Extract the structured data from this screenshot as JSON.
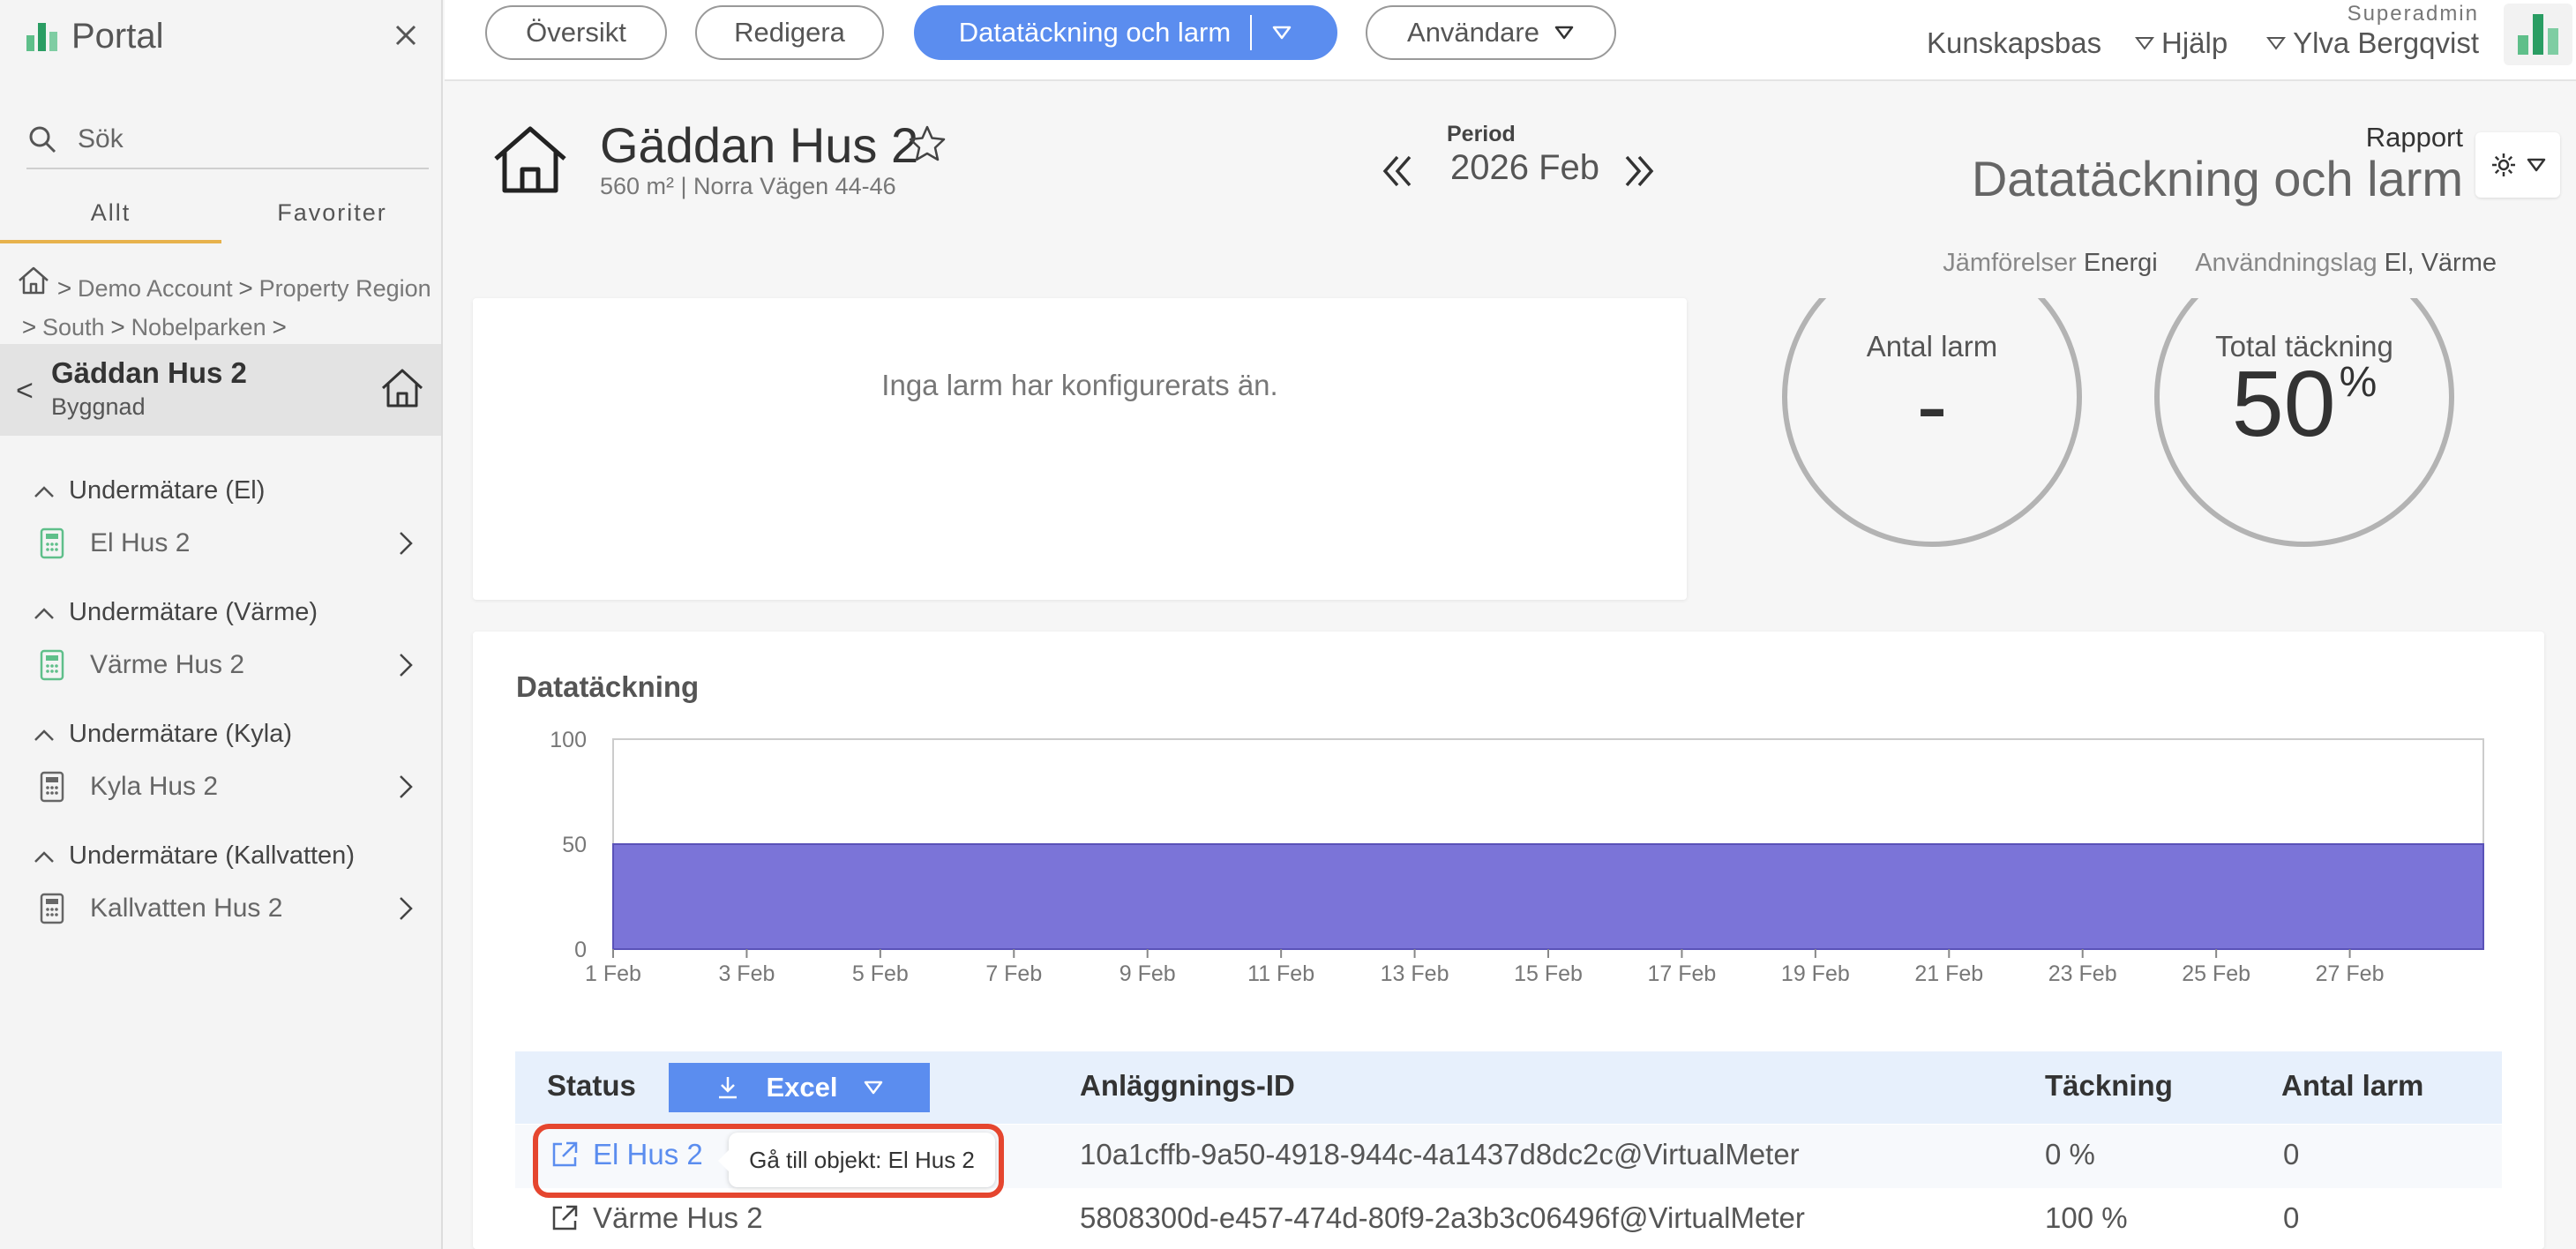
{
  "sidebar": {
    "title": "Portal",
    "search_placeholder": "Sök",
    "tabs": [
      {
        "label": "Allt"
      },
      {
        "label": "Favoriter"
      }
    ],
    "breadcrumb": [
      "Demo Account",
      "Property Region",
      "South",
      "Nobelparken"
    ],
    "current": {
      "name": "Gäddan Hus 2",
      "type": "Byggnad"
    },
    "groups": [
      {
        "title": "Undermätare (El)",
        "item": "El Hus 2",
        "icon_color": "#5fbf8a"
      },
      {
        "title": "Undermätare (Värme)",
        "item": "Värme Hus 2",
        "icon_color": "#5fbf8a"
      },
      {
        "title": "Undermätare (Kyla)",
        "item": "Kyla Hus 2",
        "icon_color": "#666666"
      },
      {
        "title": "Undermätare (Kallvatten)",
        "item": "Kallvatten Hus 2",
        "icon_color": "#666666"
      }
    ]
  },
  "topnav": {
    "tabs": [
      {
        "label": "Översikt"
      },
      {
        "label": "Redigera"
      },
      {
        "label": "Datatäckning och larm",
        "active": true
      },
      {
        "label": "Användare"
      }
    ],
    "links": {
      "knowledge": "Kunskapsbas",
      "help": "Hjälp",
      "user": "Ylva Bergqvist"
    },
    "role": "Superadmin"
  },
  "header": {
    "building_name": "Gäddan Hus 2",
    "subtitle": "560 m² | Norra Vägen 44-46",
    "period_label": "Period",
    "period_value": "2026 Feb",
    "report_label": "Rapport",
    "report_value": "Datatäckning och larm",
    "comparisons_label": "Jämförelser",
    "comparisons_value": "Energi",
    "usage_label": "Användningslag",
    "usage_value": "El, Värme"
  },
  "alarms": {
    "empty_message": "Inga larm har konfigurerats än.",
    "count_label": "Antal larm",
    "count_value": "-",
    "coverage_label": "Total täckning",
    "coverage_value": "50",
    "coverage_unit": "%"
  },
  "coverage": {
    "title": "Datatäckning"
  },
  "chart_data": {
    "type": "area",
    "title": "Datatäckning",
    "x_tick_labels": [
      "1 Feb",
      "3 Feb",
      "5 Feb",
      "7 Feb",
      "9 Feb",
      "11 Feb",
      "13 Feb",
      "15 Feb",
      "17 Feb",
      "19 Feb",
      "21 Feb",
      "23 Feb",
      "25 Feb",
      "27 Feb"
    ],
    "y_ticks": [
      0,
      50,
      100
    ],
    "ylim": [
      0,
      100
    ],
    "x_range_days": [
      1,
      29
    ],
    "series": [
      {
        "values_by_day": [
          [
            1,
            50
          ],
          [
            29,
            50
          ]
        ],
        "color": "#7b74d8"
      }
    ]
  },
  "table": {
    "headers": {
      "status": "Status",
      "id": "Anläggnings-ID",
      "coverage": "Täckning",
      "alarms": "Antal larm"
    },
    "excel_label": "Excel",
    "rows": [
      {
        "name": "El Hus 2",
        "id": "10a1cffb-9a50-4918-944c-4a1437d8dc2c@VirtualMeter",
        "coverage": "0 %",
        "alarms": "0"
      },
      {
        "name": "Värme Hus 2",
        "id": "5808300d-e457-474d-80f9-2a3b3c06496f@VirtualMeter",
        "coverage": "100 %",
        "alarms": "0"
      }
    ],
    "tooltip": "Gå till objekt: El Hus 2"
  },
  "colors": {
    "accent": "#5b8def",
    "brand": "#2a9d63",
    "chart_fill": "#7b74d8",
    "highlight": "#e5462f"
  }
}
